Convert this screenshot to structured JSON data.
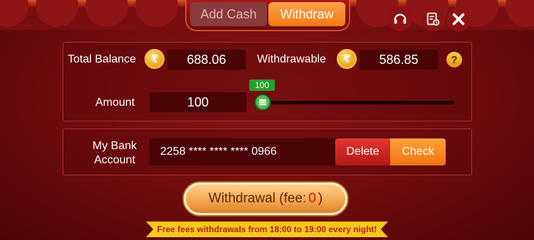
{
  "tabs": [
    {
      "label": "Add Cash",
      "active": false
    },
    {
      "label": "Withdraw",
      "active": true
    }
  ],
  "top_icons": [
    "headset-icon",
    "receipt-history-icon",
    "close-icon"
  ],
  "balance": {
    "total_label": "Total Balance",
    "total_value": "688.06",
    "withdrawable_label": "Withdrawable",
    "withdrawable_value": "586.85",
    "currency_symbol": "₹",
    "help_symbol": "?"
  },
  "amount": {
    "label": "Amount",
    "value": "100",
    "slider_value_label": "100",
    "slider_fraction": 0.0
  },
  "bank": {
    "label": "My Bank Account",
    "account_masked": "2258 **** **** **** 0966",
    "delete_label": "Delete",
    "check_label": "Check"
  },
  "withdraw_button": {
    "prefix": "Withdrawal (fee:",
    "fee": "0",
    "suffix": ")"
  },
  "notice": "Free fees withdrawals from 18:00 to 19:00 every night!",
  "colors": {
    "accent_orange": "#f27a12",
    "background_red": "#7a0d0f",
    "delete_red": "#e2392f",
    "slider_green": "#25a12a",
    "notice_yellow": "#f4c81a"
  }
}
